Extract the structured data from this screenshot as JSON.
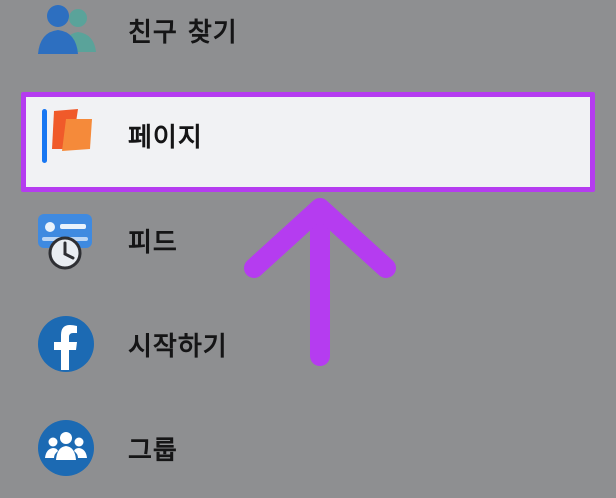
{
  "menu": {
    "items": [
      {
        "name": "friends",
        "label": "친구 찾기",
        "icon": "friends-icon"
      },
      {
        "name": "pages",
        "label": "페이지",
        "icon": "flag-icon",
        "highlighted": true
      },
      {
        "name": "feed",
        "label": "피드",
        "icon": "feed-clock-icon"
      },
      {
        "name": "get-started",
        "label": "시작하기",
        "icon": "facebook-icon"
      },
      {
        "name": "groups",
        "label": "그룹",
        "icon": "groups-icon"
      }
    ]
  },
  "annotation": {
    "type": "up-arrow-icon",
    "color": "#b53cf0"
  },
  "colors": {
    "background": "#8e8f91",
    "highlight_border": "#b53cf0",
    "highlight_fill": "#f1f2f4",
    "blue": "#1c6ab3"
  }
}
